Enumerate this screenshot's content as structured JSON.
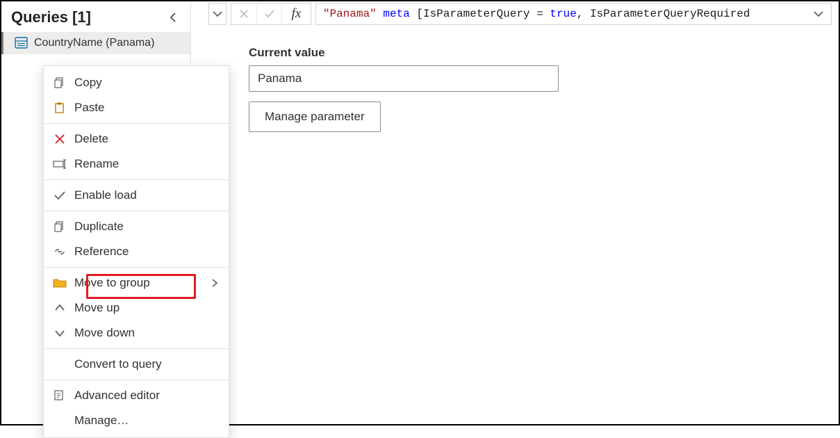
{
  "queries": {
    "title": "Queries [1]",
    "items": [
      {
        "label": "CountryName (Panama)"
      }
    ]
  },
  "formula_bar": {
    "string_literal": "\"Panama\"",
    "keyword_meta": "meta",
    "rest1": " [IsParameterQuery = ",
    "keyword_true": "true",
    "rest2": ", IsParameterQueryRequired",
    "fx_label": "fx"
  },
  "current_value": {
    "label": "Current value",
    "value": "Panama",
    "manage_button": "Manage parameter"
  },
  "context_menu": {
    "copy": "Copy",
    "paste": "Paste",
    "delete": "Delete",
    "rename": "Rename",
    "enable_load": "Enable load",
    "duplicate": "Duplicate",
    "reference": "Reference",
    "move_to_group": "Move to group",
    "move_up": "Move up",
    "move_down": "Move down",
    "convert_to_query": "Convert to query",
    "advanced_editor": "Advanced editor",
    "manage": "Manage…"
  }
}
